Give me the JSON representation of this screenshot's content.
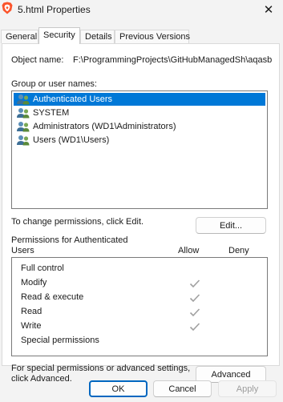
{
  "window": {
    "title": "5.html Properties",
    "close_glyph": "✕"
  },
  "tabs": [
    {
      "label": "General"
    },
    {
      "label": "Security"
    },
    {
      "label": "Details"
    },
    {
      "label": "Previous Versions"
    }
  ],
  "security": {
    "object_name_label": "Object name:",
    "object_name_value": "F:\\ProgrammingProjects\\GitHubManagedSh\\aqasb",
    "groups_label": "Group or user names:",
    "groups": [
      {
        "label": "Authenticated Users",
        "selected": true,
        "icon": "users-group-icon"
      },
      {
        "label": "SYSTEM",
        "selected": false,
        "icon": "users-group-icon"
      },
      {
        "label": "Administrators (WD1\\Administrators)",
        "selected": false,
        "icon": "users-group-icon"
      },
      {
        "label": "Users (WD1\\Users)",
        "selected": false,
        "icon": "users-group-icon"
      }
    ],
    "change_permissions_text": "To change permissions, click Edit.",
    "edit_button": "Edit...",
    "permissions_for_label": "Permissions for Authenticated Users",
    "allow_header": "Allow",
    "deny_header": "Deny",
    "permissions": [
      {
        "name": "Full control",
        "allow": false,
        "deny": false
      },
      {
        "name": "Modify",
        "allow": true,
        "deny": false
      },
      {
        "name": "Read & execute",
        "allow": true,
        "deny": false
      },
      {
        "name": "Read",
        "allow": true,
        "deny": false
      },
      {
        "name": "Write",
        "allow": true,
        "deny": false
      },
      {
        "name": "Special permissions",
        "allow": false,
        "deny": false
      }
    ],
    "special_text": "For special permissions or advanced settings, click Advanced.",
    "advanced_button": "Advanced"
  },
  "footer": {
    "ok": "OK",
    "cancel": "Cancel",
    "apply": "Apply"
  },
  "colors": {
    "selection": "#0078d7",
    "ok_border": "#0067c0",
    "app_icon": "#e8541e"
  }
}
